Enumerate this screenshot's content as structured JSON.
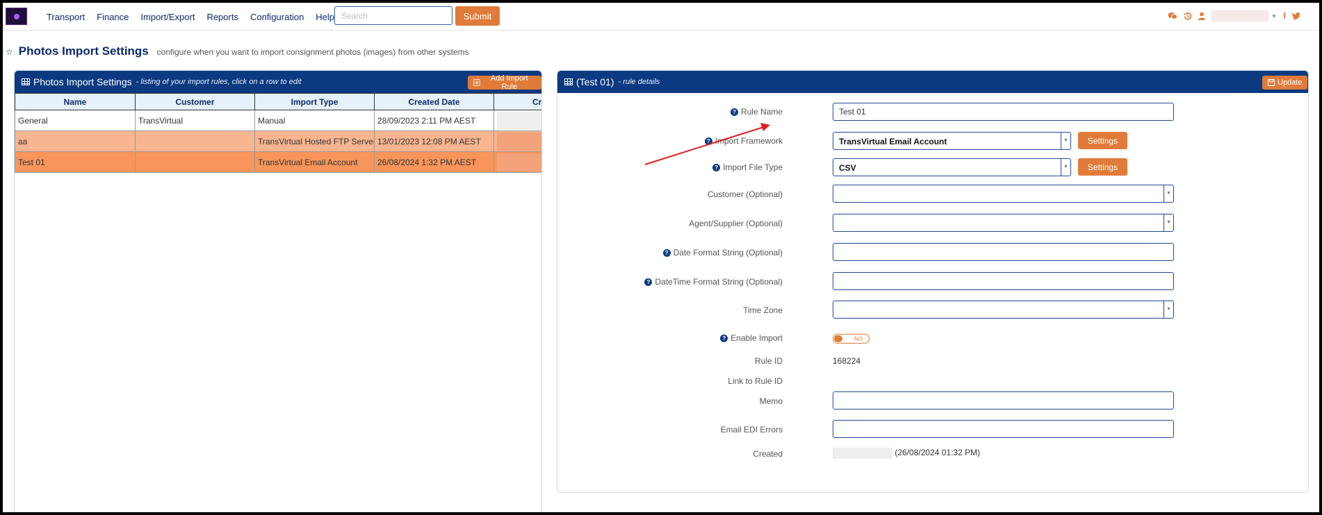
{
  "nav": {
    "items": [
      "Transport",
      "Finance",
      "Import/Export",
      "Reports",
      "Configuration",
      "Help"
    ],
    "search_placeholder": "Search",
    "submit_label": "Submit",
    "icons": [
      "chat-icon",
      "history-icon",
      "user-icon",
      "facebook-icon",
      "twitter-icon"
    ],
    "social_f": "f",
    "social_t": "🐦"
  },
  "page": {
    "title": "Photos Import Settings",
    "subtitle": "configure when you want to import consignment photos (images) from other systems"
  },
  "list_panel": {
    "title": "Photos Import Settings",
    "subtitle": "- listing of your import rules, click on a row to edit",
    "add_button": "Add Import Rule",
    "columns": [
      "Name",
      "Customer",
      "Import Type",
      "Created Date",
      "Created by"
    ],
    "rows": [
      {
        "name": "General",
        "customer": "TransVirtual",
        "import_type": "Manual",
        "created_date": "28/09/2023 2:11 PM AEST"
      },
      {
        "name": "aa",
        "customer": "",
        "import_type": "TransVirtual Hosted FTP Server",
        "created_date": "13/01/2023 12:08 PM AEST"
      },
      {
        "name": "Test 01",
        "customer": "",
        "import_type": "TransVirtual Email Account",
        "created_date": "26/08/2024 1:32 PM AEST"
      }
    ]
  },
  "detail_panel": {
    "title": "(Test 01)",
    "subtitle": "- rule details",
    "update_button": "Update",
    "fields": {
      "rule_name_label": "Rule Name",
      "rule_name_value": "Test 01",
      "framework_label": "Import Framework",
      "framework_value": "TransVirtual Email Account",
      "file_type_label": "Import File Type",
      "file_type_value": "CSV",
      "settings_label": "Settings",
      "customer_label": "Customer (Optional)",
      "agent_label": "Agent/Supplier (Optional)",
      "date_format_label": "Date Format String (Optional)",
      "datetime_format_label": "DateTime Format String (Optional)",
      "timezone_label": "Time Zone",
      "enable_import_label": "Enable Import",
      "enable_import_state": "NO",
      "rule_id_label": "Rule ID",
      "rule_id_value": "168224",
      "link_rule_label": "Link to Rule ID",
      "memo_label": "Memo",
      "email_errors_label": "Email EDI Errors",
      "created_label": "Created",
      "created_value": "(26/08/2024 01:32 PM)"
    }
  },
  "colors": {
    "navy": "#0b3a80",
    "orange": "#e07b39",
    "row_highlight": "#f8b58f",
    "row_selected": "#f7955a"
  }
}
